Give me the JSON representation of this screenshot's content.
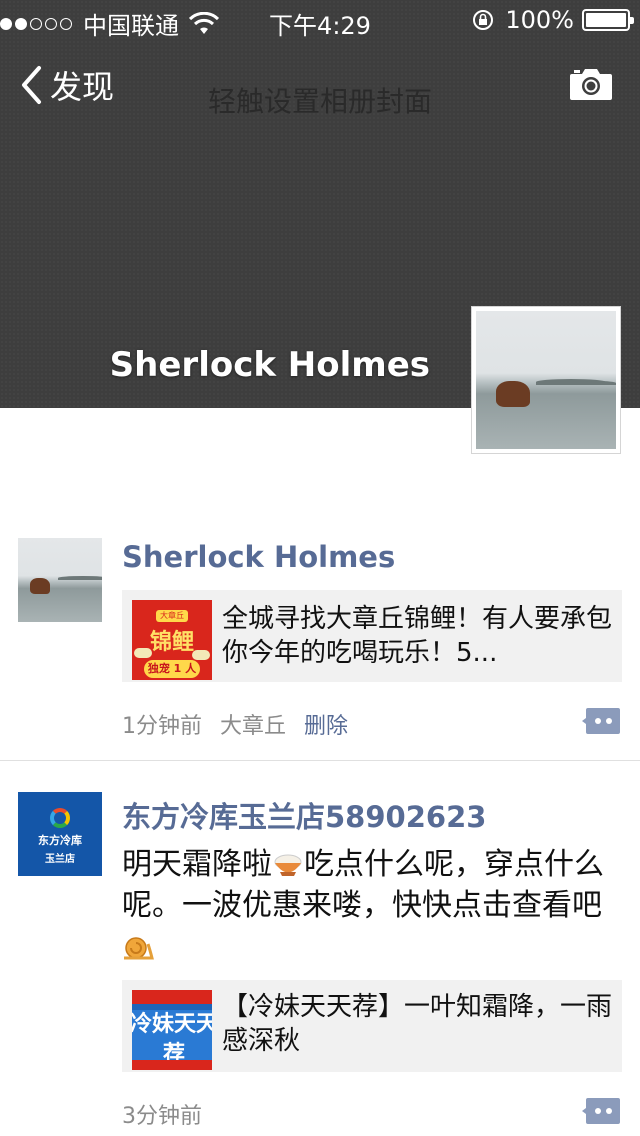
{
  "status_bar": {
    "carrier": "中国联通",
    "time": "下午4:29",
    "battery": "100%"
  },
  "nav": {
    "back_label": "发现",
    "cover_hint": "轻触设置相册封面"
  },
  "profile": {
    "name": "Sherlock Holmes"
  },
  "posts": [
    {
      "author": "Sherlock Holmes",
      "link_thumb": {
        "top_tag": "大章丘",
        "main": "锦鲤",
        "bottom": "独宠 1 人"
      },
      "link_title": "全城寻找大章丘锦鲤！有人要承包你今年的吃喝玩乐！5...",
      "time": "1分钟前",
      "location": "大章丘",
      "delete_label": "删除"
    },
    {
      "author": "东方冷库玉兰店58902623",
      "avatar": {
        "line1": "东方冷库",
        "line2": "玉兰店"
      },
      "text_part1": "明天霜降啦",
      "text_part2": "吃点什么呢，穿点什么呢。一波优惠来喽，快快点击查看吧",
      "link_thumb": {
        "main": "冷妹天天荐"
      },
      "link_title": "【冷妹天天荐】一叶知霜降，一雨感深秋",
      "time": "3分钟前"
    }
  ]
}
